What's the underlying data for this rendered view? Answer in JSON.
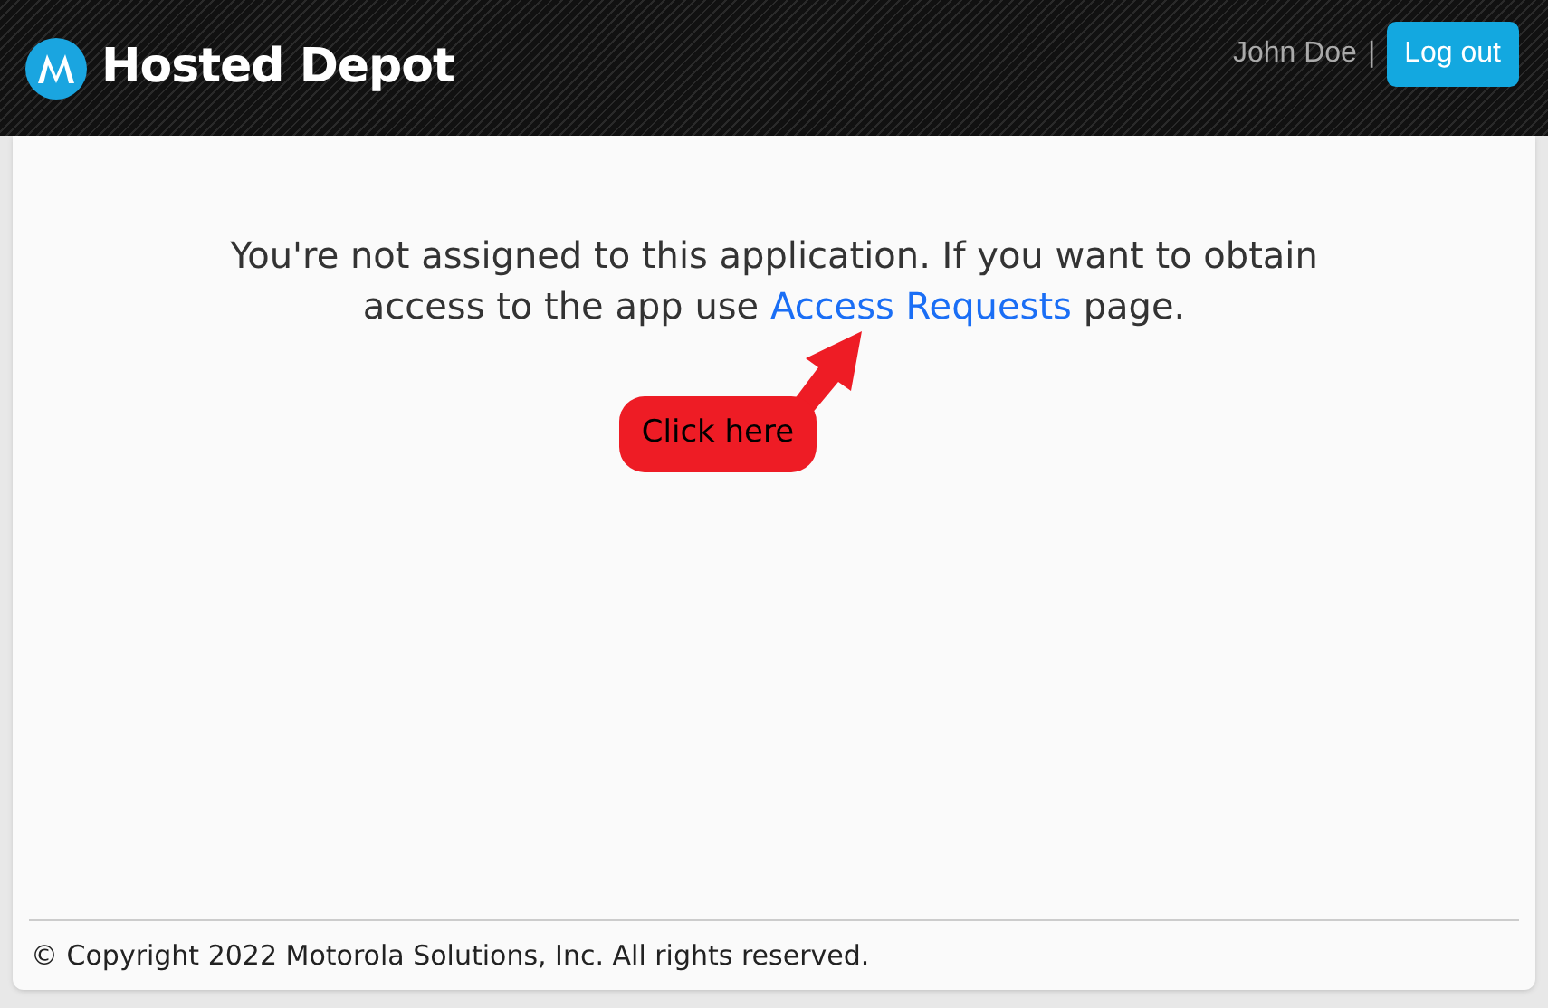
{
  "header": {
    "brand": "Hosted Depot",
    "user": "John Doe",
    "separator": "|",
    "logout": "Log out"
  },
  "message": {
    "text": "You're not assigned to this application. If you want to obtain access to the app use",
    "link": "Access Requests",
    "after": "page."
  },
  "callout": {
    "label": "Click here"
  },
  "footer": {
    "copyright": "© Copyright 2022 Motorola Solutions, Inc. All rights reserved."
  }
}
